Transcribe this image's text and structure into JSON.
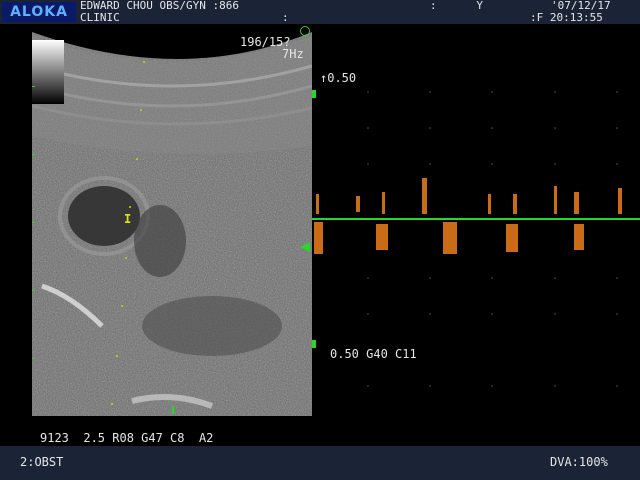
{
  "header": {
    "brand": "ALOKA",
    "clinic_line1": "EDWARD CHOU OBS/GYN :866",
    "clinic_line2": "CLINIC",
    "colon": ":",
    "y_label": ":      Y",
    "date": "'07/12/17",
    "time": ":F 20:13:55"
  },
  "bmode": {
    "scale_label": "196/15?",
    "freq_label": "7Hz",
    "caliper": "I"
  },
  "doppler": {
    "top_scale": "↑0.50",
    "bottom_scale": "0.50 G40 C11"
  },
  "params": "9123  2.5 R08 G47 C8  A2",
  "footer": {
    "mode": "2:OBST",
    "dva": "DVA:100%"
  },
  "colors": {
    "header_bg": "#1b2436",
    "green_marker": "#2bd62b",
    "doppler_orange": "#e0781a"
  }
}
